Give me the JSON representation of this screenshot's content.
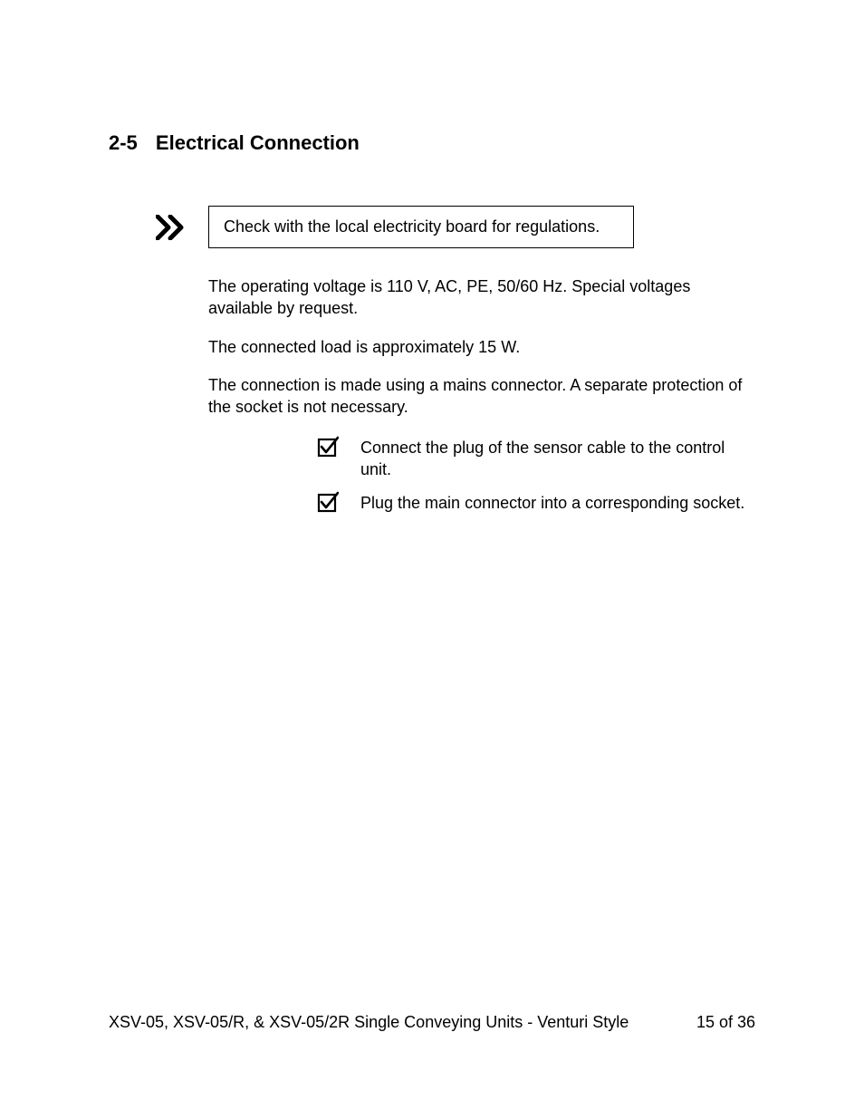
{
  "heading": {
    "number": "2-5",
    "title": "Electrical Connection"
  },
  "notice": {
    "text": "Check with the local electricity board for regulations."
  },
  "paragraphs": {
    "p1": "The operating voltage is 110 V, AC, PE, 50/60 Hz.  Special voltages available by request.",
    "p2": "The connected load is approximately 15 W.",
    "p3": "The connection is made using a mains connector.   A separate protection of the socket is not necessary."
  },
  "checks": {
    "c1": "Connect the plug of the sensor cable to the control unit.",
    "c2": "Plug the main connector into a corresponding socket."
  },
  "footer": {
    "title": "XSV-05, XSV-05/R, & XSV-05/2R Single Conveying Units - Venturi Style",
    "page": "15 of 36"
  }
}
